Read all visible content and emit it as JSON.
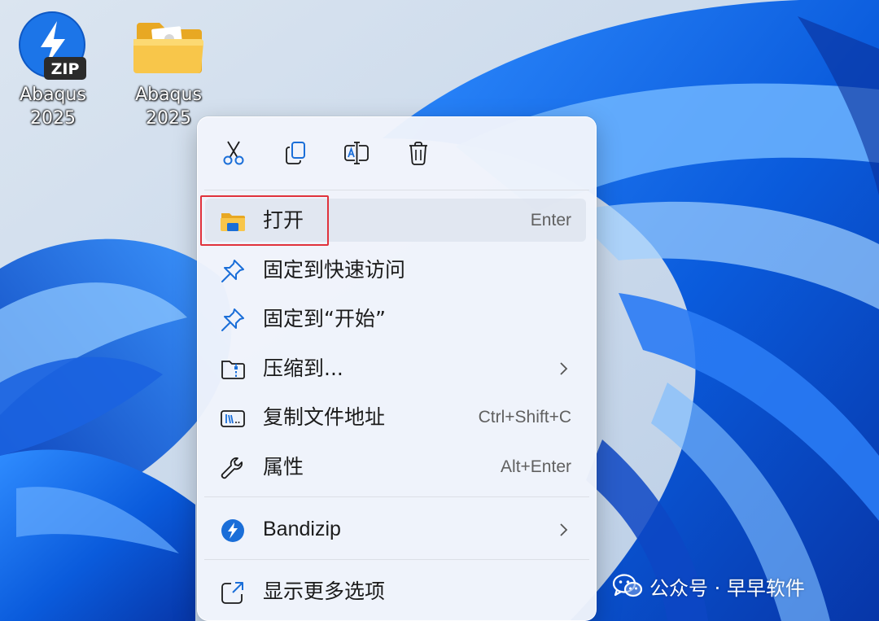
{
  "desktop": {
    "icons": [
      {
        "label": "Abaqus 2025",
        "badge": "ZIP",
        "icon": "bandizip-archive-icon"
      },
      {
        "label": "Abaqus 2025",
        "icon": "folder-icon"
      }
    ]
  },
  "context_menu": {
    "quick_actions": [
      {
        "icon": "cut-icon"
      },
      {
        "icon": "copy-icon"
      },
      {
        "icon": "rename-icon"
      },
      {
        "icon": "delete-icon"
      }
    ],
    "items": [
      {
        "label": "打开",
        "shortcut": "Enter",
        "icon": "folder-open-icon",
        "highlighted": true
      },
      {
        "label": "固定到快速访问",
        "icon": "pin-icon"
      },
      {
        "label": "固定到“开始”",
        "icon": "pin-icon"
      },
      {
        "label": "压缩到...",
        "icon": "zip-folder-icon",
        "submenu": true
      },
      {
        "label": "复制文件地址",
        "shortcut": "Ctrl+Shift+C",
        "icon": "copy-path-icon"
      },
      {
        "label": "属性",
        "shortcut": "Alt+Enter",
        "icon": "wrench-icon"
      },
      {
        "label": "Bandizip",
        "icon": "bandizip-icon",
        "submenu": true
      },
      {
        "label": "显示更多选项",
        "icon": "show-more-icon"
      }
    ]
  },
  "watermark": {
    "text": "公众号 · 早早软件",
    "icon": "wechat-icon"
  },
  "colors": {
    "accent": "#1a6ed8",
    "highlight_border": "#e0323c",
    "folder_yellow": "#f8c64a"
  }
}
